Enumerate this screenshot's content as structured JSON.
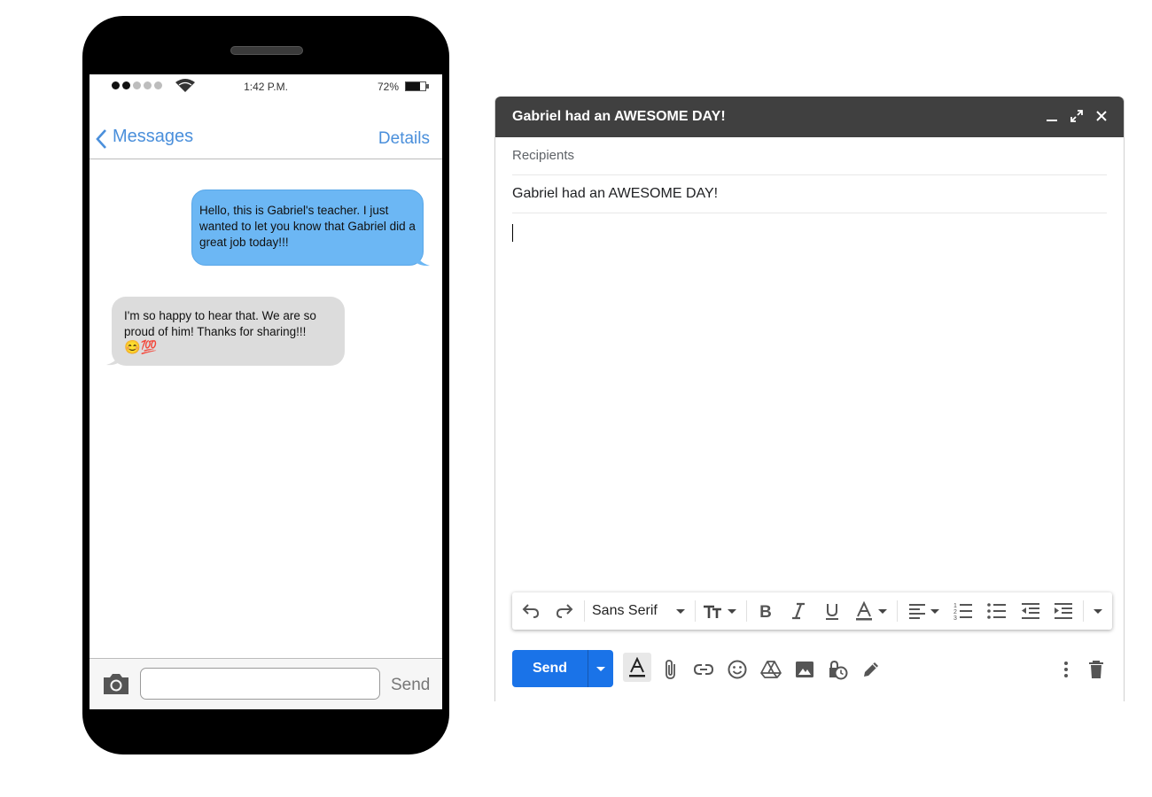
{
  "phone": {
    "status_bar": {
      "time": "1:42 P.M.",
      "battery": "72%"
    },
    "nav": {
      "back_label": "Messages",
      "details_label": "Details"
    },
    "messages": [
      {
        "direction": "outgoing",
        "text": "Hello, this is Gabriel's teacher.  I just wanted to let you know that Gabriel did a great job today!!!"
      },
      {
        "direction": "incoming",
        "text": "I'm so happy to hear that.  We are so proud of him! Thanks for sharing!!!",
        "emoji": "😊💯"
      }
    ],
    "input": {
      "value": "",
      "send_label": "Send"
    },
    "icons": [
      "camera-icon",
      "wifi-icon",
      "battery-icon",
      "chevron-left-icon"
    ]
  },
  "compose": {
    "title": "Gabriel had an AWESOME DAY!",
    "header_icons": [
      "minimize-icon",
      "expand-icon",
      "close-icon"
    ],
    "recipients_placeholder": "Recipients",
    "subject": "Gabriel had an AWESOME DAY!",
    "body": "",
    "format_toolbar": {
      "font": "Sans Serif",
      "icons": [
        "undo-icon",
        "redo-icon",
        "text-size-icon",
        "bold-icon",
        "italic-icon",
        "underline-icon",
        "text-color-icon",
        "align-icon",
        "numbered-list-icon",
        "bulleted-list-icon",
        "indent-less-icon",
        "indent-more-icon",
        "more-formatting-icon"
      ]
    },
    "bottom_toolbar": {
      "send_label": "Send",
      "icons": [
        "formatting-options-icon",
        "attach-icon",
        "link-icon",
        "emoji-icon",
        "drive-icon",
        "photo-icon",
        "confidential-mode-icon",
        "signature-icon",
        "more-options-icon",
        "delete-icon"
      ]
    },
    "colors": {
      "header": "#404040",
      "send_button": "#1a73e8",
      "bubble_outgoing": "#6cb7f4",
      "bubble_incoming": "#dcdcdc",
      "ios_blue": "#4a8fdb"
    }
  }
}
